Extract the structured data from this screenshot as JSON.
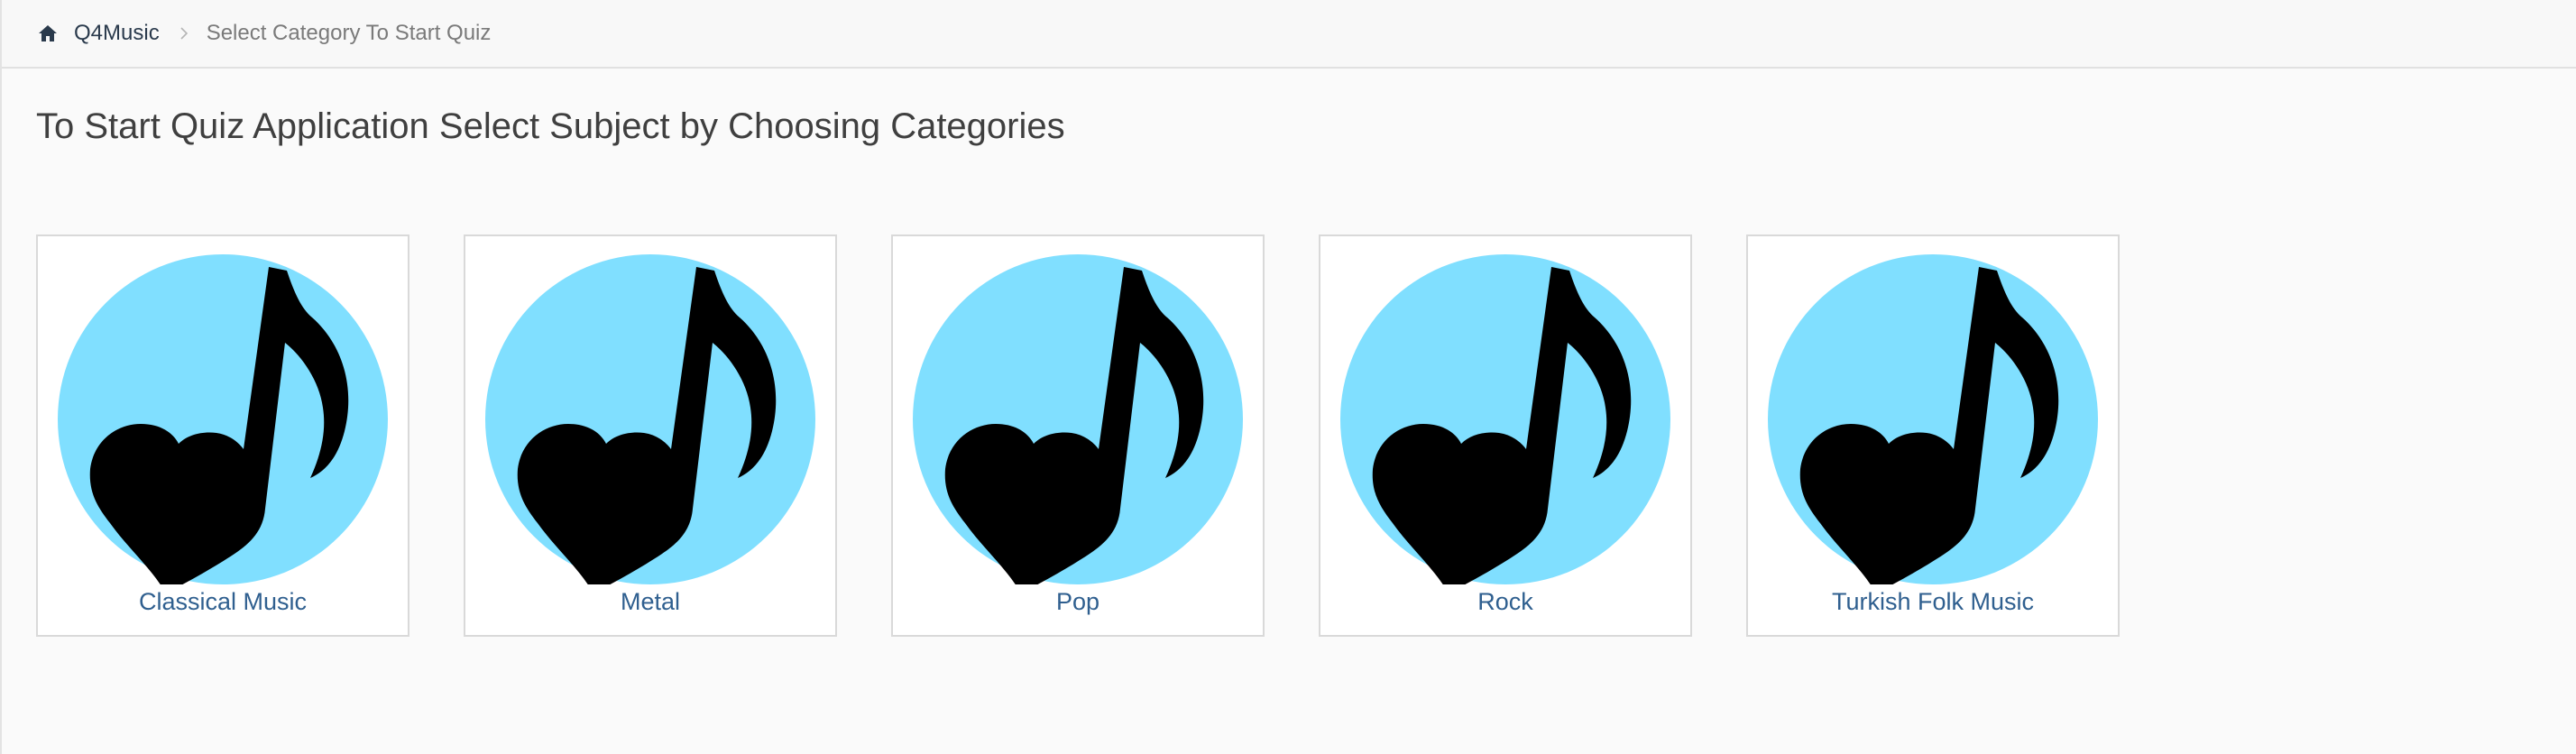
{
  "breadcrumb": {
    "home_label": "Q4Music",
    "current_label": "Select Category To Start Quiz"
  },
  "page_title": "To Start Quiz Application Select Subject by Choosing Categories",
  "categories": [
    {
      "label": "Classical Music"
    },
    {
      "label": "Metal"
    },
    {
      "label": "Pop"
    },
    {
      "label": "Rock"
    },
    {
      "label": "Turkish Folk Music"
    }
  ],
  "colors": {
    "icon_background": "#80dfff",
    "icon_foreground": "#000000",
    "link": "#2f5f8f"
  },
  "icons": {
    "home": "home-icon",
    "separator": "chevron-right-icon",
    "category": "music-note-heart-icon"
  }
}
